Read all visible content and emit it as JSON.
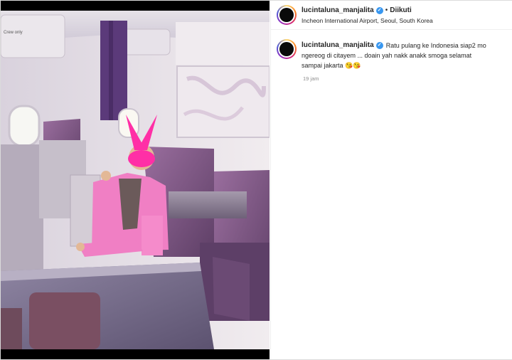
{
  "post": {
    "username": "lucintaluna_manjalita",
    "dot": "•",
    "follow_label": "Diikuti",
    "location": "Incheon International Airport, Seoul, South Korea"
  },
  "caption": {
    "username": "lucintaluna_manjalita",
    "line1": "Ratu pulang ke Indonesia siap2 mo",
    "line2": "ngereog di citayem ... doain yah nakk anakk smoga selamat",
    "line3": "sampai jakarta",
    "emoji": "😘😘",
    "timestamp": "19 jam"
  },
  "photo": {
    "sign_text": "Crew only"
  },
  "colors": {
    "verified_blue": "#3897f0",
    "text_primary": "#262626",
    "text_secondary": "#8e8e8e",
    "mask_pink": "#ff2fa6",
    "suit_pink": "#f07fc4",
    "cabin_purple": "#7a5a8e"
  },
  "icons": [
    "verified-badge-icon"
  ]
}
